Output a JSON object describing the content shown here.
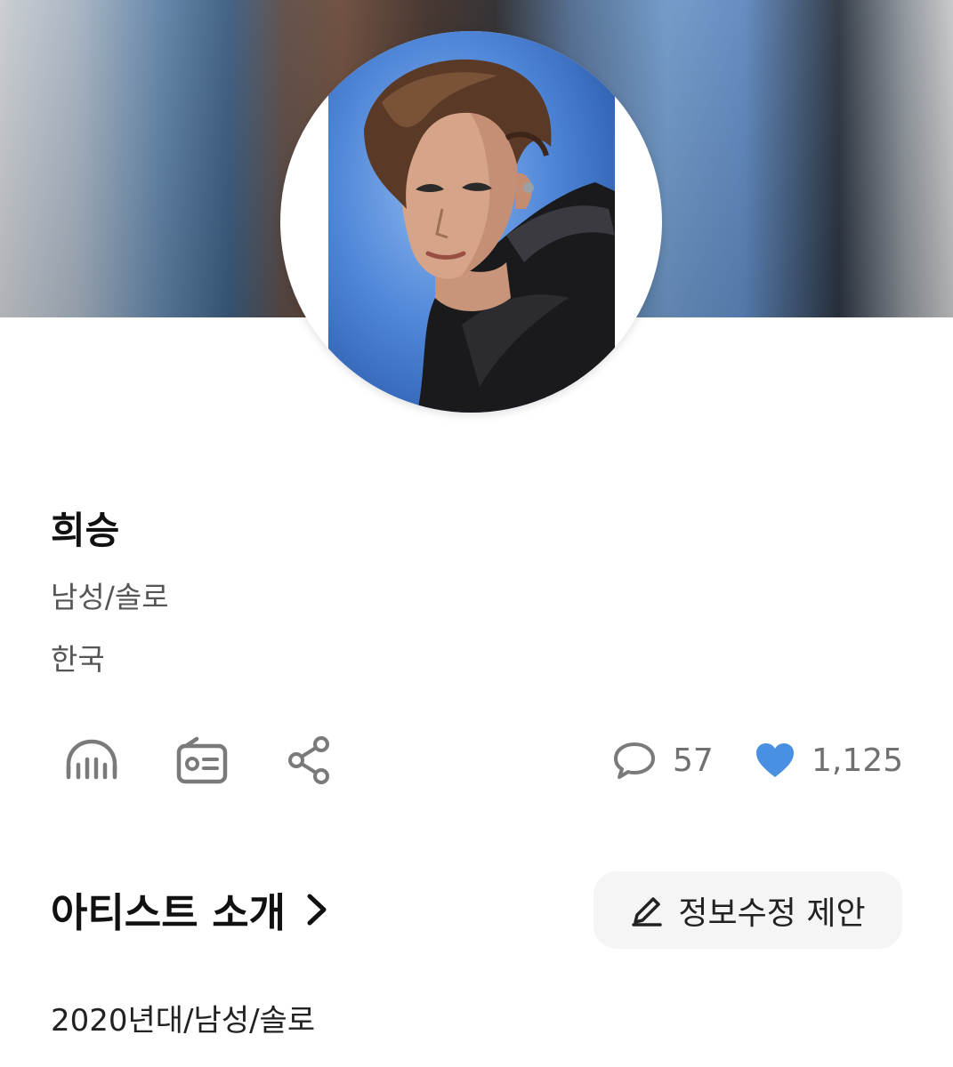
{
  "artist": {
    "name": "희승",
    "gender_type": "남성/솔로",
    "country": "한국"
  },
  "actions": {
    "listen_icon": "headphones-icon",
    "radio_icon": "radio-icon",
    "share_icon": "share-icon"
  },
  "stats": {
    "comment_icon": "speech-bubble-icon",
    "comments": "57",
    "like_icon": "heart-icon",
    "likes": "1,125",
    "like_color": "#4a90e2"
  },
  "intro_section": {
    "title": "아티스트 소개",
    "suggest_edit_label": "정보수정 제안",
    "tags": "2020년대/남성/솔로"
  }
}
